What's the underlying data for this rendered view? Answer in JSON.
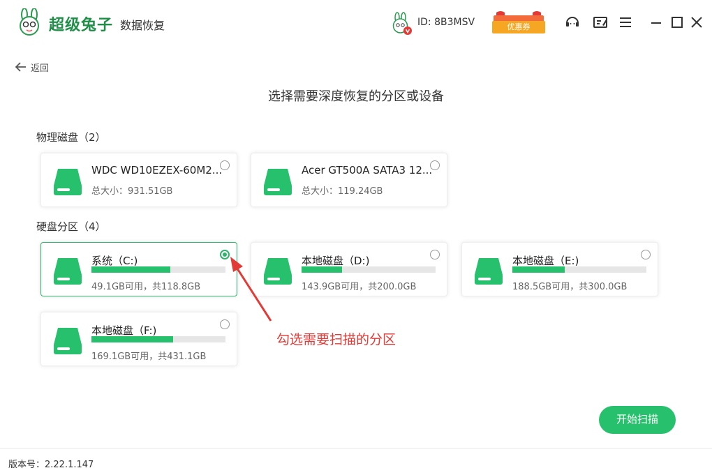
{
  "app": {
    "logo_text": "超级兔子",
    "logo_subtitle": "数据恢复",
    "user_id": "ID: 8B3MSV",
    "coupon_label": "优惠券"
  },
  "nav": {
    "back_label": "返回"
  },
  "page": {
    "title": "选择需要深度恢复的分区或设备"
  },
  "physical": {
    "title": "物理磁盘（2）",
    "disks": [
      {
        "name": "WDC WD10EZEX-60M2...",
        "size": "总大小：931.51GB"
      },
      {
        "name": "Acer GT500A SATA3 12...",
        "size": "总大小：119.24GB"
      }
    ]
  },
  "partitions": {
    "title": "硬盘分区（4）",
    "items": [
      {
        "name": "系统（C:)",
        "usage": "49.1GB可用，共118.8GB",
        "used_fraction": 0.59,
        "selected": true
      },
      {
        "name": "本地磁盘（D:)",
        "usage": "143.9GB可用，共200.0GB",
        "used_fraction": 0.3,
        "selected": false
      },
      {
        "name": "本地磁盘（E:)",
        "usage": "188.5GB可用，共300.0GB",
        "used_fraction": 0.39,
        "selected": false
      },
      {
        "name": "本地磁盘（F:)",
        "usage": "169.1GB可用，共431.1GB",
        "used_fraction": 0.61,
        "selected": false
      }
    ]
  },
  "annotation": "勾选需要扫描的分区",
  "actions": {
    "scan_label": "开始扫描"
  },
  "footer": {
    "version": "版本号：2.22.1.147"
  },
  "colors": {
    "accent": "#27c16d",
    "annotation": "#e23a36",
    "coupon": "#f5a623"
  },
  "icons": [
    "rabbit-logo-icon",
    "avatar-icon",
    "coupon-icon",
    "customer-service-icon",
    "feedback-icon",
    "menu-icon",
    "minimize-icon",
    "maximize-icon",
    "close-icon",
    "back-arrow-icon",
    "disk-icon",
    "radio-icon"
  ]
}
